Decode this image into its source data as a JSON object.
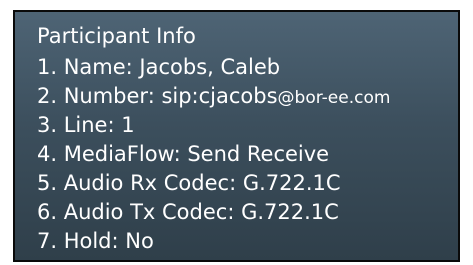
{
  "panel": {
    "title": "Participant Info",
    "rows": [
      {
        "label": "1. Name: Jacobs, Caleb"
      },
      {
        "label": "2. Number: sip:cjacobs",
        "suffix": "@bor-ee.com"
      },
      {
        "label": "3. Line: 1"
      },
      {
        "label": "4. MediaFlow: Send Receive"
      },
      {
        "label": "5. Audio Rx Codec: G.722.1C"
      },
      {
        "label": "6. Audio Tx Codec: G.722.1C"
      },
      {
        "label": "7. Hold: No"
      }
    ]
  },
  "colors": {
    "panel_top": "#4e6475",
    "panel_bottom": "#2f3f4a",
    "text": "#ffffff",
    "border": "#0a0a0a"
  }
}
